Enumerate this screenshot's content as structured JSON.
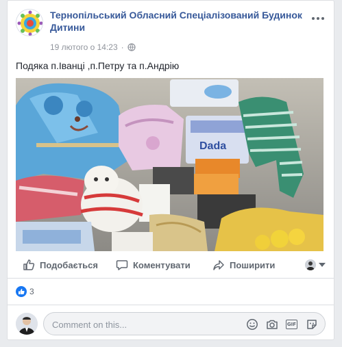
{
  "post": {
    "page_name": "Тернопільський Обласний Спеціалізований Будинок Дитини",
    "date": "19 лютого о 14:23",
    "separator": "·",
    "audience_icon": "globe-icon",
    "text": "Подяка п.Іванці ,п.Петру та п.Андрію"
  },
  "actions": {
    "like_label": "Подобається",
    "comment_label": "Коментувати",
    "share_label": "Поширити"
  },
  "reactions": {
    "count": "3",
    "type": "like"
  },
  "comment": {
    "placeholder": "Comment on this...",
    "icons": [
      "emoji-icon",
      "camera-icon",
      "gif-icon",
      "sticker-icon"
    ]
  },
  "colors": {
    "page_name": "#365899",
    "like_blue": "#1877f2",
    "secondary_text": "#606770"
  }
}
